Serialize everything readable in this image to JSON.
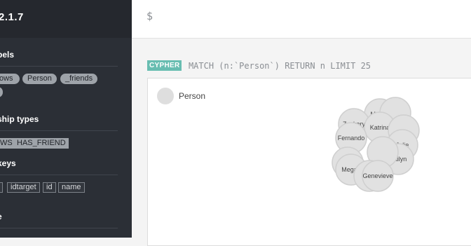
{
  "sidebar": {
    "version": "2.1.7",
    "labels_title": "bels",
    "labels": [
      "ows",
      "Person",
      "_friends"
    ],
    "rel_title": "ship types",
    "rel_types": [
      "WS",
      "HAS_FRIEND"
    ],
    "keys_title": "keys",
    "keys": [
      "idtarget",
      "id",
      "name"
    ],
    "last_title": "e"
  },
  "editor": {
    "prompt": "$"
  },
  "query": {
    "badge": "CYPHER",
    "text": "MATCH (n:`Person`) RETURN n LIMIT 25"
  },
  "legend": {
    "label": "Person"
  },
  "graph": {
    "node_color": "#e1e1e1",
    "node_stroke": "#cfcfcf",
    "nodes": [
      {
        "label": "Mason"
      },
      {
        "label": ""
      },
      {
        "label": "Zackary"
      },
      {
        "label": "Katrina"
      },
      {
        "label": ""
      },
      {
        "label": "Fernando"
      },
      {
        "label": "Jolie"
      },
      {
        "label": "Kailyn"
      },
      {
        "label": ""
      },
      {
        "label": "La"
      },
      {
        "label": "Megan"
      },
      {
        "label": "Fe"
      },
      {
        "label": "Genevieve"
      }
    ]
  }
}
